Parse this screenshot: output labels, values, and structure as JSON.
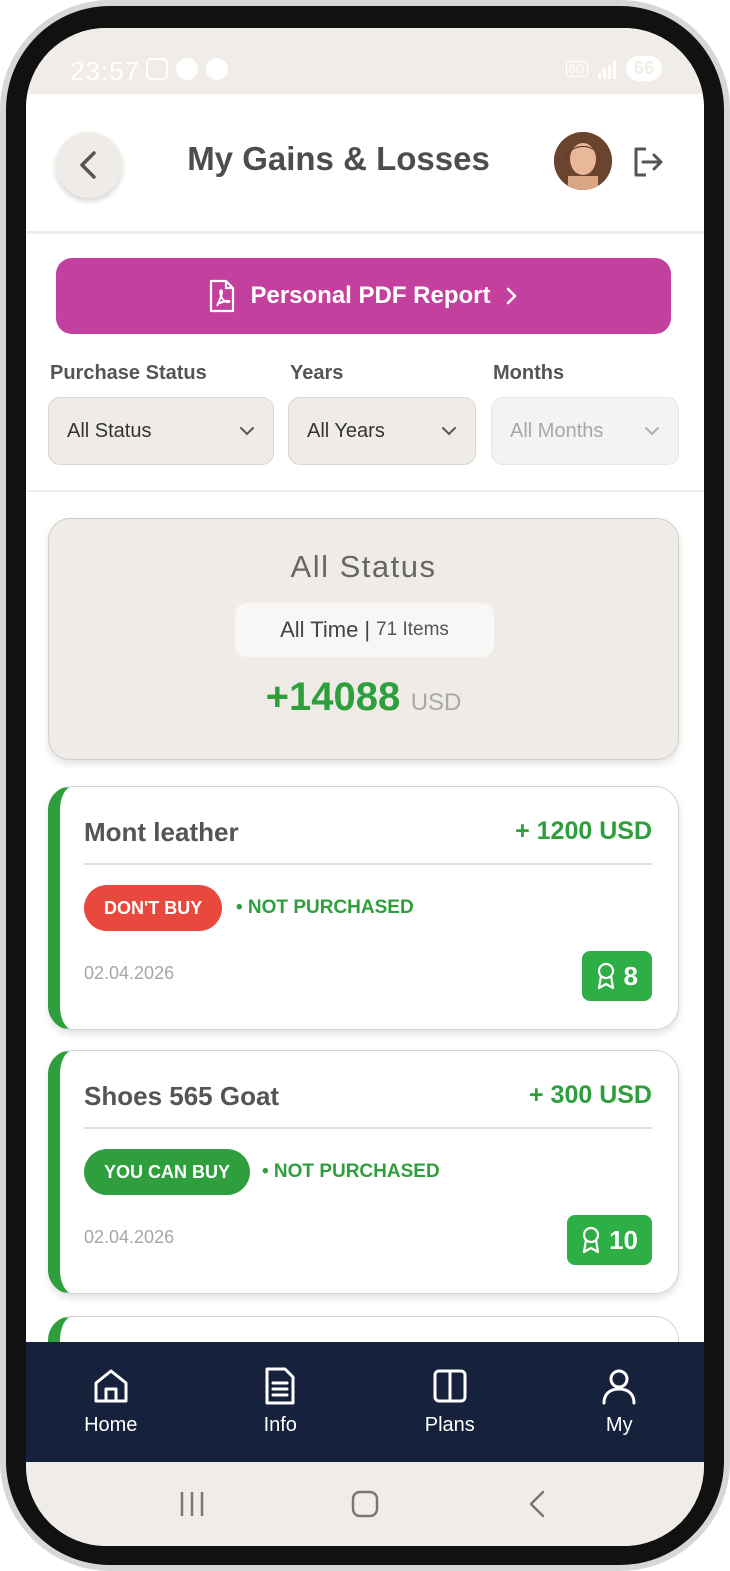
{
  "status_bar": {
    "time": "23:57",
    "network": "5G",
    "battery": "66"
  },
  "header": {
    "title": "My Gains & Losses"
  },
  "pdf_report": {
    "label": "Personal PDF Report"
  },
  "filters": [
    {
      "label": "Purchase Status",
      "value": "All Status",
      "disabled": false
    },
    {
      "label": "Years",
      "value": "All Years",
      "disabled": false
    },
    {
      "label": "Months",
      "value": "All Months",
      "disabled": true
    }
  ],
  "summary": {
    "title": "All Status",
    "period": "All Time",
    "separator": "|",
    "count": "71 Items",
    "total": "+14088",
    "currency": "USD"
  },
  "items": [
    {
      "name": "Mont leather",
      "amount": "+ 1200 USD",
      "recommendation": "DON'T BUY",
      "purchase_status": "• NOT PURCHASED",
      "date": "02.04.2026",
      "score": "8"
    },
    {
      "name": "Shoes 565 Goat",
      "amount": "+ 300 USD",
      "recommendation": "YOU CAN BUY",
      "purchase_status": "• NOT PURCHASED",
      "date": "02.04.2026",
      "score": "10"
    }
  ],
  "nav": [
    {
      "label": "Home",
      "icon": "home-icon"
    },
    {
      "label": "Info",
      "icon": "document-icon"
    },
    {
      "label": "Plans",
      "icon": "book-icon"
    },
    {
      "label": "My",
      "icon": "user-icon"
    }
  ],
  "colors": {
    "accent_green": "#2e9f3c",
    "badge_red": "#e8483d",
    "pdf_magenta": "#c4409f",
    "nav_background": "#16223b"
  }
}
